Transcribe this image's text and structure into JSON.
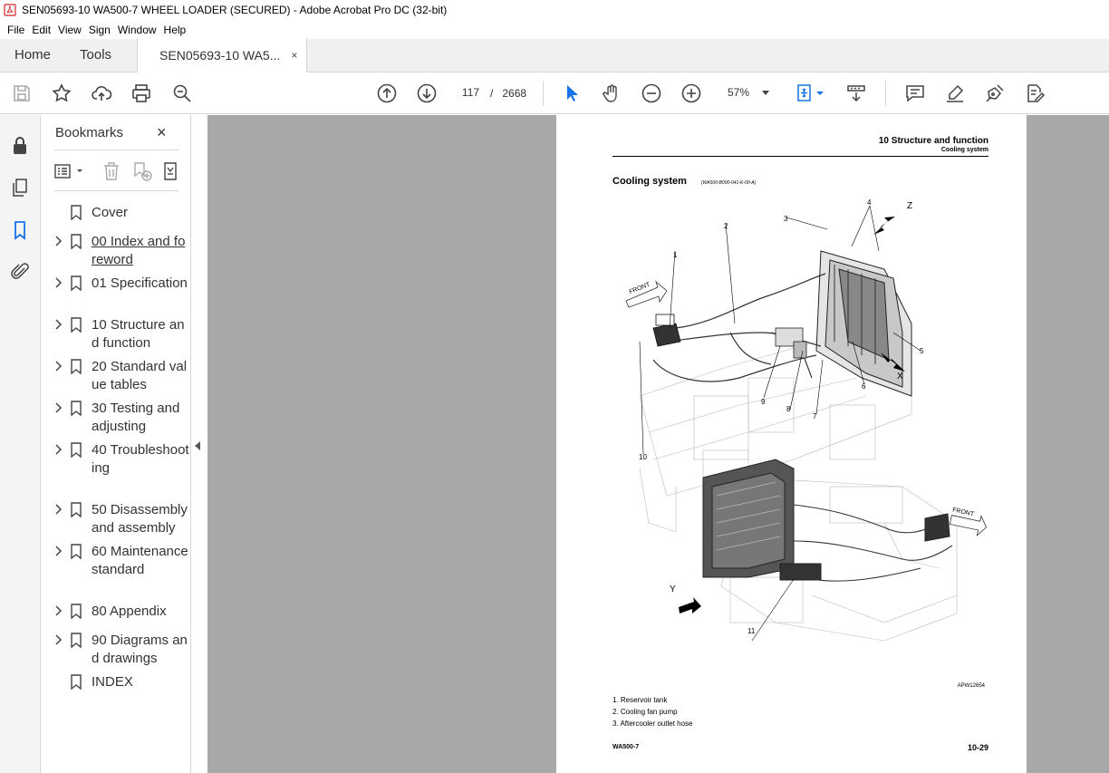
{
  "window": {
    "title": "SEN05693-10 WA500-7 WHEEL LOADER (SECURED) - Adobe Acrobat Pro DC (32-bit)"
  },
  "menu": [
    "File",
    "Edit",
    "View",
    "Sign",
    "Window",
    "Help"
  ],
  "tabs": {
    "home": "Home",
    "tools": "Tools",
    "document": "SEN05693-10 WA5...",
    "close": "×"
  },
  "toolbar": {
    "page_current": "117",
    "page_separator": "/",
    "page_total": "2668",
    "zoom": "57%"
  },
  "bookmarks": {
    "title": "Bookmarks",
    "close": "×",
    "items": [
      {
        "label": "Cover",
        "expandable": false,
        "underline": false
      },
      {
        "label": "00 Index and foreword",
        "expandable": true,
        "underline": true
      },
      {
        "label": "01 Specification",
        "expandable": true,
        "underline": false
      },
      {
        "label": "10 Structure and function",
        "expandable": true,
        "underline": false
      },
      {
        "label": "20 Standard value tables",
        "expandable": true,
        "underline": false
      },
      {
        "label": "30 Testing and adjusting",
        "expandable": true,
        "underline": false
      },
      {
        "label": "40 Troubleshooting",
        "expandable": true,
        "underline": false
      },
      {
        "label": "50 Disassembly and assembly",
        "expandable": true,
        "underline": false
      },
      {
        "label": "60 Maintenance standard",
        "expandable": true,
        "underline": false
      },
      {
        "label": "80 Appendix",
        "expandable": true,
        "underline": false
      },
      {
        "label": "90 Diagrams and drawings",
        "expandable": true,
        "underline": false
      },
      {
        "label": "INDEX",
        "expandable": false,
        "underline": false
      }
    ]
  },
  "document": {
    "header_title": "10 Structure and function",
    "header_subtitle": "Cooling system",
    "section_title": "Cooling system",
    "section_code": "(WA500-B000-041-K-00-A)",
    "figure_id": "APW12654",
    "callouts": [
      "1",
      "2",
      "3",
      "4",
      "5",
      "6",
      "7",
      "8",
      "9",
      "10",
      "11"
    ],
    "view_labels": [
      "X",
      "Y",
      "Z"
    ],
    "front_label": "FRONT",
    "legend": [
      "1. Reservoir tank",
      "2. Cooling fan pump",
      "3. Aftercooler outlet hose"
    ],
    "footer_left": "WA500-7",
    "footer_right": "10-29"
  },
  "colors": {
    "accent": "#1473e6",
    "doc_background": "#a8a8a8"
  }
}
